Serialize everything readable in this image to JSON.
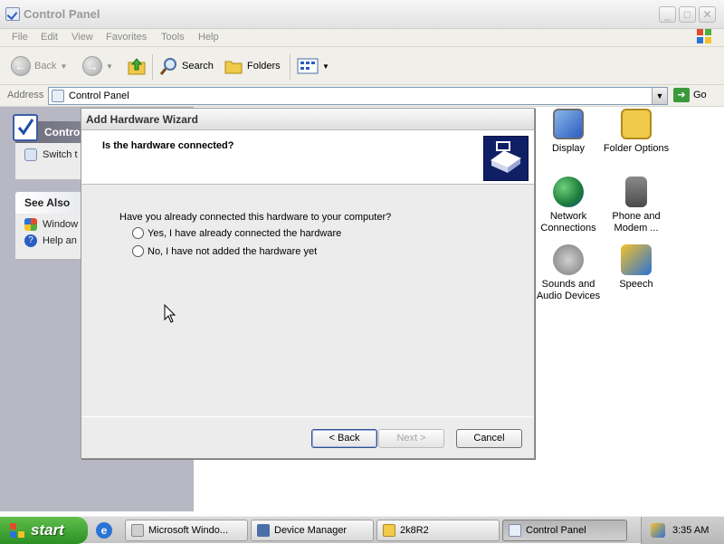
{
  "window": {
    "title": "Control Panel",
    "controls": {
      "minimize": "_",
      "maximize": "□",
      "close": "✕"
    }
  },
  "menu": [
    "File",
    "Edit",
    "View",
    "Favorites",
    "Tools",
    "Help"
  ],
  "toolbar": {
    "back": "Back",
    "search": "Search",
    "folders": "Folders"
  },
  "address": {
    "label": "Address",
    "value": "Control Panel",
    "go": "Go"
  },
  "left_pane": {
    "control_panel": {
      "title": "Contro",
      "switch": "Switch t"
    },
    "see_also": {
      "title": "See Also",
      "items": [
        "Window",
        "Help an"
      ]
    }
  },
  "icons": [
    {
      "label": "Display"
    },
    {
      "label": "Folder Options"
    },
    {
      "label": "Network Connections"
    },
    {
      "label": "Phone and Modem ..."
    },
    {
      "label": "Sounds and Audio Devices"
    },
    {
      "label": "Speech"
    }
  ],
  "dialog": {
    "title": "Add Hardware Wizard",
    "heading": "Is the hardware connected?",
    "question": "Have you already connected this hardware to your computer?",
    "options": [
      "Yes, I have already connected the hardware",
      "No, I have not added the hardware yet"
    ],
    "buttons": {
      "back": "< Back",
      "next": "Next >",
      "cancel": "Cancel"
    }
  },
  "taskbar": {
    "start": "start",
    "tasks": [
      "Microsoft Windo...",
      "Device Manager",
      "2k8R2",
      "Control Panel"
    ],
    "clock": "3:35 AM"
  },
  "colors": {
    "dialog_bg": "#ececec",
    "start_green": "#3a9a30",
    "hw_icon_bg": "#0f1f66"
  }
}
